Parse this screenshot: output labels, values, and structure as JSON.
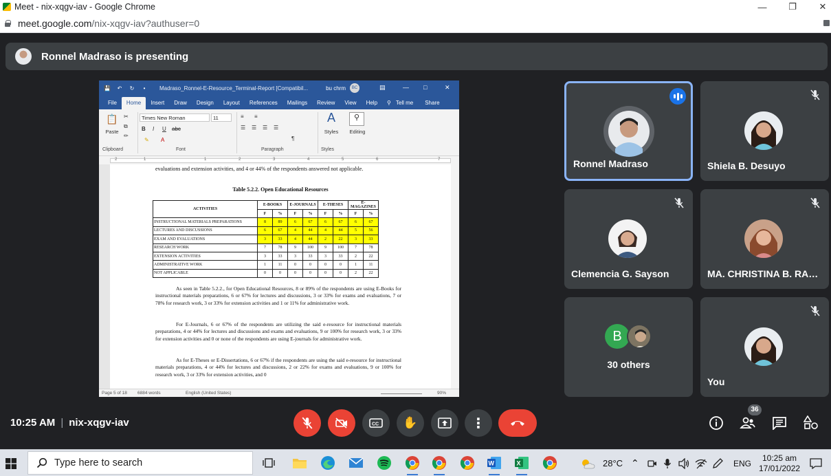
{
  "browser": {
    "window_title": "Meet - nix-xqgv-iav - Google Chrome",
    "url_main": "meet.google.com",
    "url_rest": "/nix-xqgv-iav?authuser=0"
  },
  "banner": {
    "text": "Ronnel Madraso is presenting"
  },
  "word": {
    "doc_title": "Madraso_Ronnel-E-Resource_Terminal-Report [Compatibil...",
    "user": "bu chrm",
    "user_initials": "BC",
    "tabs": [
      "File",
      "Home",
      "Insert",
      "Draw",
      "Design",
      "Layout",
      "References",
      "Mailings",
      "Review",
      "View",
      "Help"
    ],
    "tell_me": "Tell me",
    "share": "Share",
    "font_name": "Times New Roman",
    "font_size": "11",
    "paste": "Paste",
    "styles": "Styles",
    "editing": "Editing",
    "groups": {
      "clipboard": "Clipboard",
      "font": "Font",
      "paragraph": "Paragraph",
      "styles": "Styles"
    },
    "ruler_numbers": [
      "2",
      "1",
      "1",
      "2",
      "3",
      "4",
      "5",
      "6",
      "7"
    ],
    "status": {
      "page": "Page 5 of 18",
      "words": "6884 words",
      "language": "English (United States)",
      "zoom": "90%"
    }
  },
  "document": {
    "top_line": "evaluations and extension activities, and 4 or 44% of the respondents answered not applicable.",
    "table_title": "Table 5.2.2. Open Educational Resources",
    "table": {
      "col_groups": [
        "E-BOOKS",
        "E-JOURNALS",
        "E-THESES",
        "E-MAGAZINES"
      ],
      "sub_headers": [
        "F",
        "%",
        "F",
        "%",
        "F",
        "%",
        "F",
        "%"
      ],
      "activities_header": "ACTIVITIES",
      "rows": [
        {
          "label": "INSTRUCTIONAL MATERIALS PREPARATIONS",
          "values": [
            "8",
            "89",
            "6",
            "67",
            "6",
            "67",
            "6",
            "67"
          ],
          "highlight": true
        },
        {
          "label": "LECTURES AND DISCUSSIONS",
          "values": [
            "6",
            "67",
            "4",
            "44",
            "4",
            "44",
            "5",
            "56"
          ],
          "highlight": true
        },
        {
          "label": "EXAM AND EVALUATIONS",
          "values": [
            "3",
            "33",
            "4",
            "44",
            "2",
            "22",
            "3",
            "33"
          ],
          "highlight": true
        },
        {
          "label": "RESEARCH WORK",
          "values": [
            "7",
            "78",
            "9",
            "100",
            "9",
            "100",
            "7",
            "78"
          ],
          "highlight": false
        },
        {
          "label": "EXTENSION ACTIVITIES",
          "values": [
            "3",
            "33",
            "3",
            "33",
            "3",
            "33",
            "2",
            "22"
          ],
          "highlight": false
        },
        {
          "label": "ADMINISTRATIVE WORK",
          "values": [
            "1",
            "11",
            "0",
            "0",
            "0",
            "0",
            "1",
            "11"
          ],
          "highlight": false
        },
        {
          "label": "NOT APPLICABLE",
          "values": [
            "0",
            "0",
            "0",
            "0",
            "0",
            "0",
            "2",
            "22"
          ],
          "highlight": false
        }
      ]
    },
    "para1": "As seen in Table 5.2.2., for Open Educational Resources, 8 or 89% of the respondents are using E-Books for instructional materials preparations, 6 or 67% for lectures and discussions, 3 or 33% for exams and evaluations, 7 or 78% for research work, 3 or 33% for extension activities and 1 or 11% for administrative work.",
    "para2": "For E-Journals, 6 or 67% of the respondents are utilizing the said e-resource for instructional materials preparations, 4 or 44% for lectures and discussions and exams and evaluations, 9 or 100% for research work, 3 or 33% for extension activities and 0 or none of the respondents are using E-journals for administrative work.",
    "para3": "As for E-Theses or E-Dissertations, 6 or 67% if the respondents are using the said e-resource for instructional materials preparations, 4 or 44% for lectures and discussions, 2 or 22% for exams and evaluations, 9 or 100% for research work, 3 or 33% for extension activities, and 0"
  },
  "participants": {
    "p1": "Ronnel Madraso",
    "p2": "Shiela B. Desuyo",
    "p3": "Clemencia G. Sayson",
    "p4": "MA. CHRISTINA B. RAN...",
    "others_initial": "B",
    "others": "30 others",
    "you": "You"
  },
  "meetbar": {
    "time": "10:25 AM",
    "meeting_code": "nix-xqgv-iav",
    "participant_count": "36"
  },
  "taskbar": {
    "search_placeholder": "Type here to search",
    "weather": "28°C",
    "language": "ENG",
    "time": "10:25 am",
    "date": "17/01/2022"
  },
  "colors": {
    "meet_bg": "#202124",
    "tile_bg": "#3c4043",
    "accent_blue": "#8ab4f8",
    "red": "#ea4335",
    "word_blue": "#2b579a",
    "highlight_yellow": "#ffff00"
  }
}
